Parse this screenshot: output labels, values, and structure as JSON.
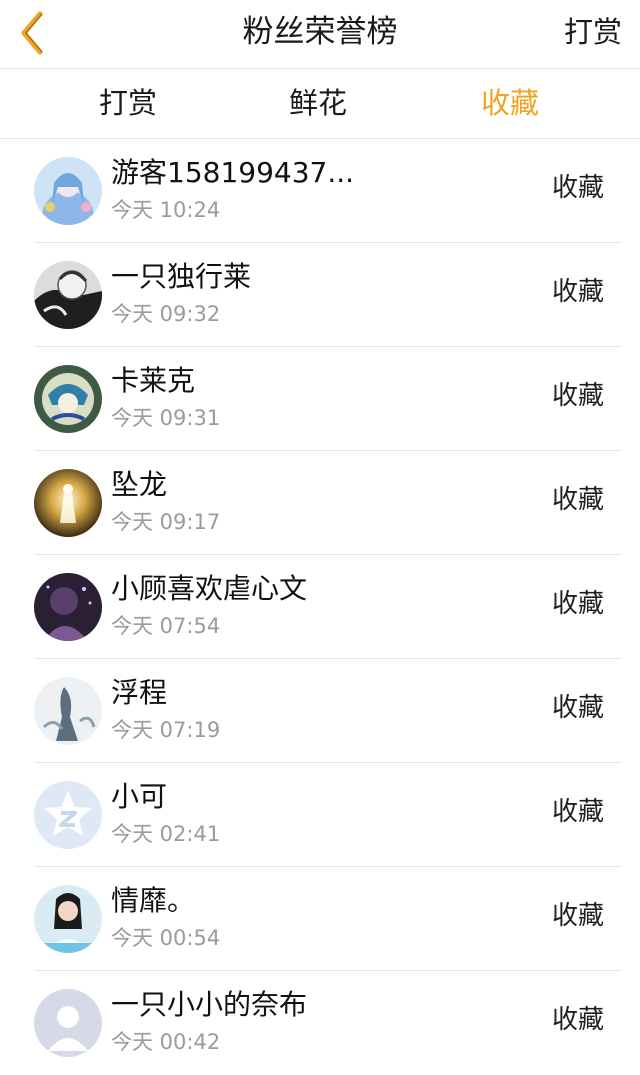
{
  "header": {
    "title": "粉丝荣誉榜",
    "right_action": "打赏",
    "back_icon": "chevron-left-icon",
    "accent_color": "#f0a323"
  },
  "tabs": [
    {
      "label": "打赏",
      "active": false
    },
    {
      "label": "鲜花",
      "active": false
    },
    {
      "label": "收藏",
      "active": true
    }
  ],
  "rows": [
    {
      "name": "游客158199437...",
      "time": "今天 10:24",
      "type": "收藏",
      "avatar": "anime-girl-blue-avatar"
    },
    {
      "name": "一只独行莱",
      "time": "今天 09:32",
      "type": "收藏",
      "avatar": "monochrome-sketch-avatar"
    },
    {
      "name": "卡莱克",
      "time": "今天 09:31",
      "type": "收藏",
      "avatar": "anime-character-green-avatar"
    },
    {
      "name": "坠龙",
      "time": "今天 09:17",
      "type": "收藏",
      "avatar": "golden-light-avatar"
    },
    {
      "name": "小顾喜欢虐心文",
      "time": "今天 07:54",
      "type": "收藏",
      "avatar": "dark-purple-avatar"
    },
    {
      "name": "浮程",
      "time": "今天 07:19",
      "type": "收藏",
      "avatar": "ink-painting-avatar"
    },
    {
      "name": "小可",
      "time": "今天 02:41",
      "type": "收藏",
      "avatar": "default-star-avatar"
    },
    {
      "name": "情靡。",
      "time": "今天 00:54",
      "type": "收藏",
      "avatar": "girl-photo-avatar"
    },
    {
      "name": "一只小小的奈布",
      "time": "今天 00:42",
      "type": "收藏",
      "avatar": "default-person-avatar"
    }
  ]
}
